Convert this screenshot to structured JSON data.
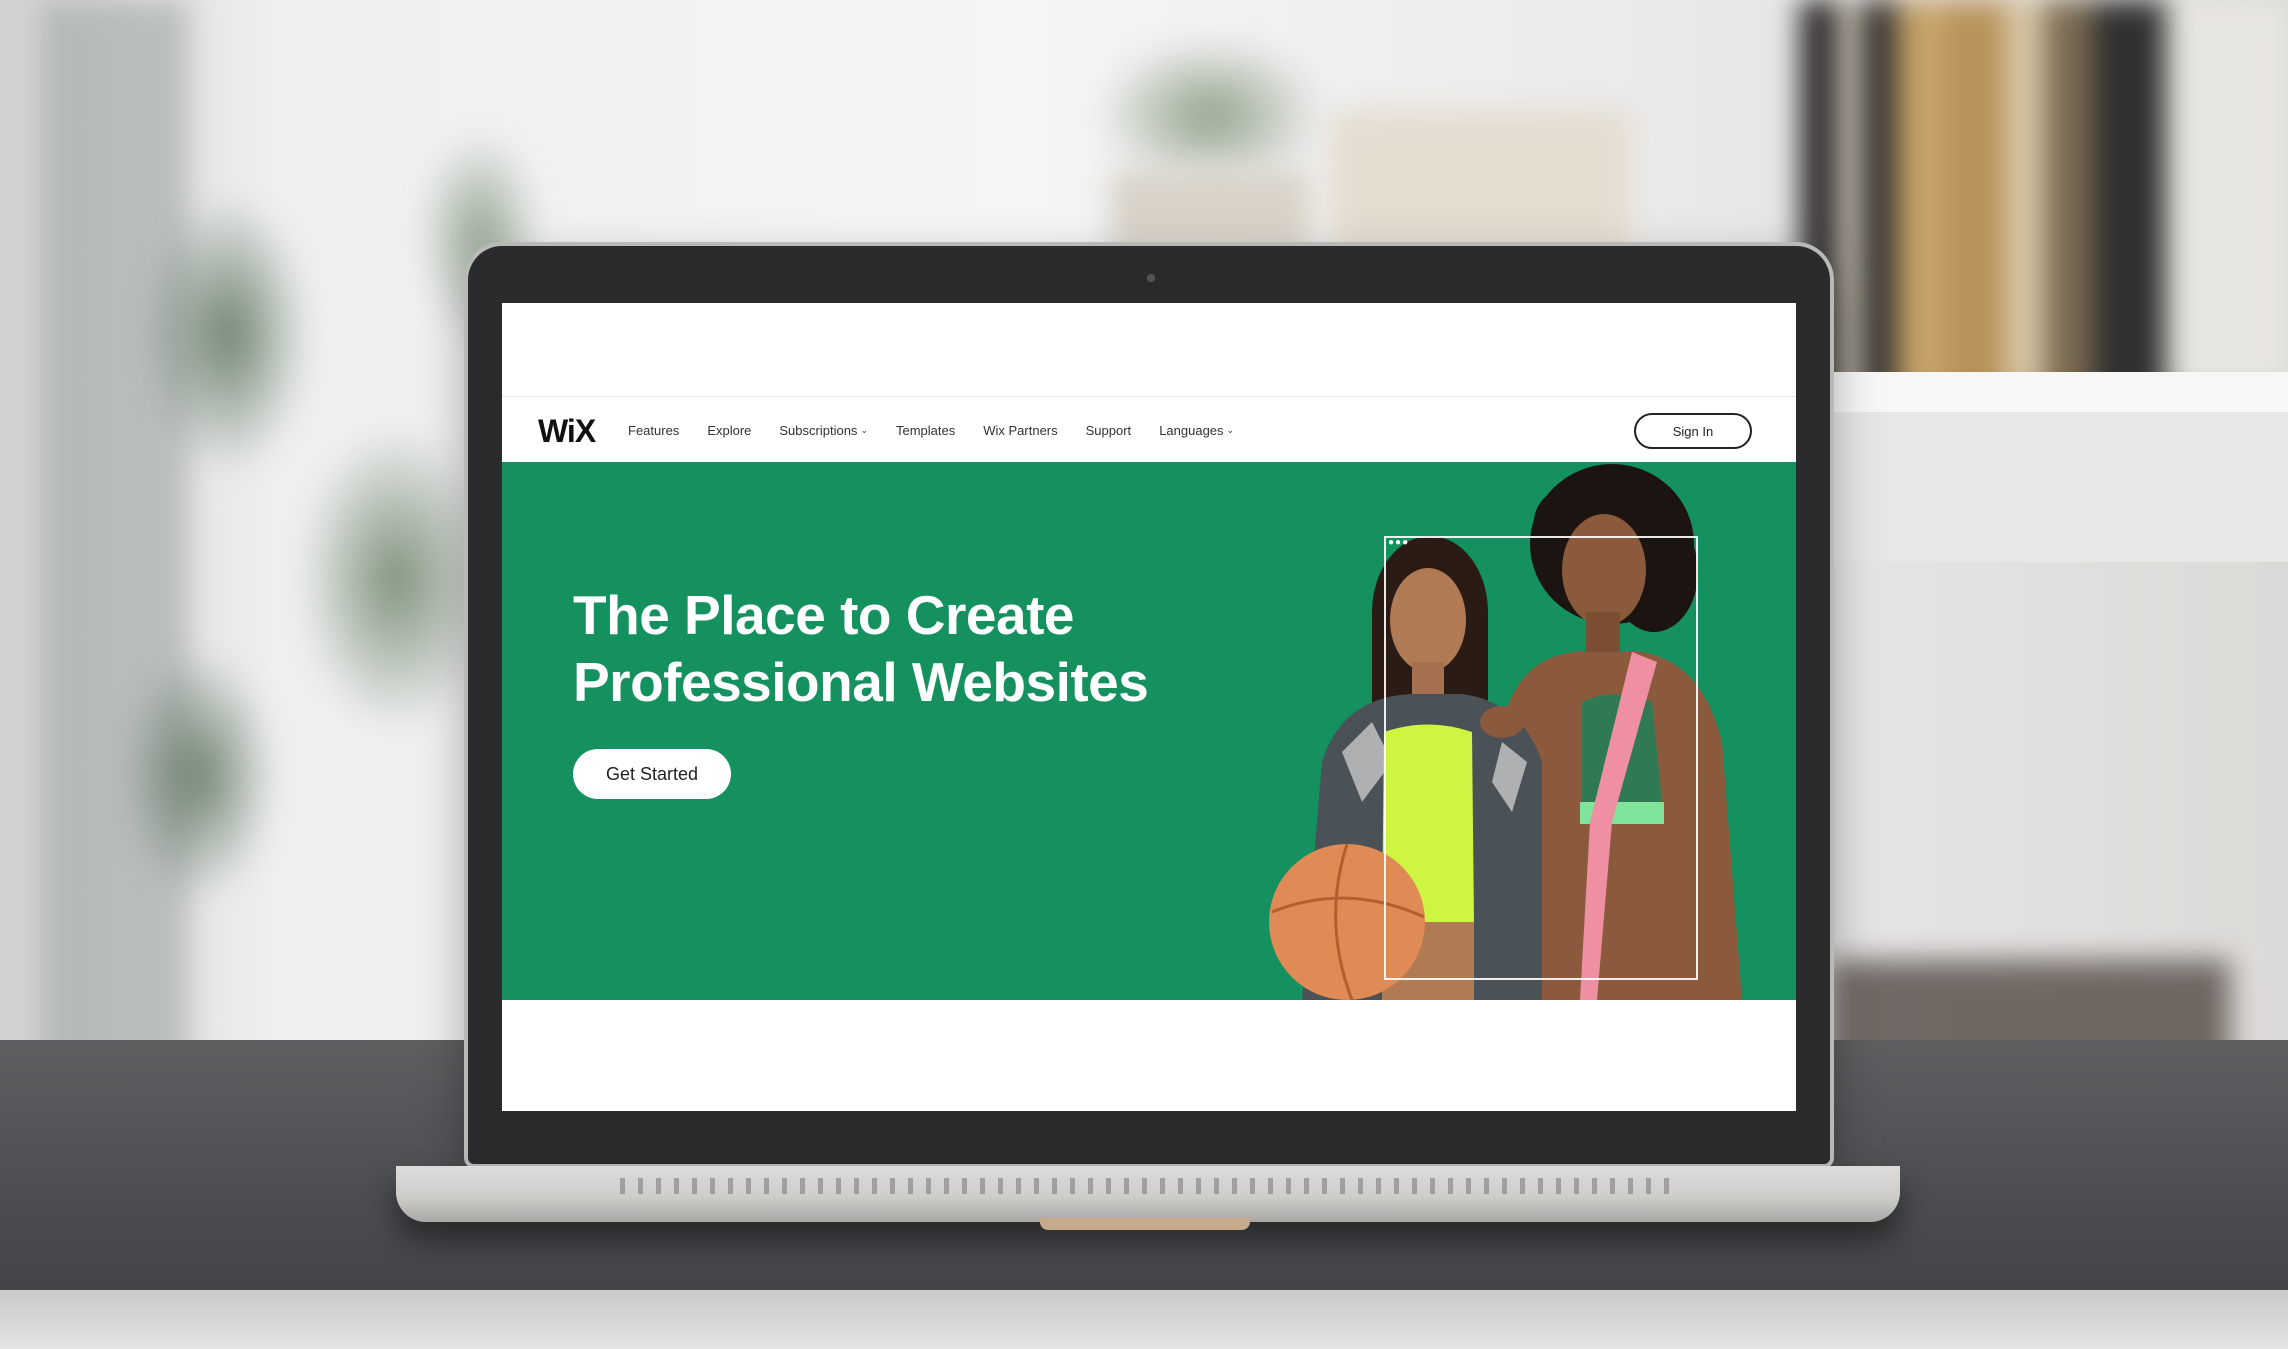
{
  "site": {
    "logo": "WiX",
    "nav": {
      "items": [
        {
          "label": "Features",
          "dropdown": false
        },
        {
          "label": "Explore",
          "dropdown": false
        },
        {
          "label": "Subscriptions",
          "dropdown": true
        },
        {
          "label": "Templates",
          "dropdown": false
        },
        {
          "label": "Wix Partners",
          "dropdown": false
        },
        {
          "label": "Support",
          "dropdown": false
        },
        {
          "label": "Languages",
          "dropdown": true
        }
      ],
      "sign_in": "Sign In"
    },
    "hero": {
      "headline_line1": "The Place to Create",
      "headline_line2": "Professional Websites",
      "cta": "Get Started",
      "background_color": "#14915f"
    }
  }
}
